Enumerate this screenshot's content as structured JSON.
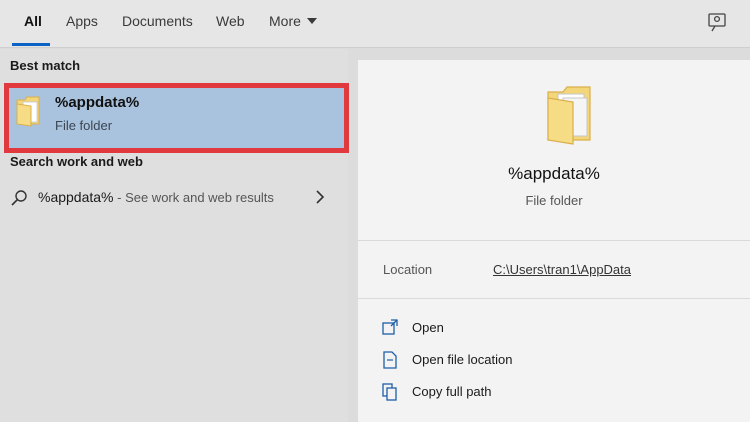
{
  "tabs": [
    {
      "label": "All",
      "active": true
    },
    {
      "label": "Apps",
      "active": false
    },
    {
      "label": "Documents",
      "active": false
    },
    {
      "label": "Web",
      "active": false
    },
    {
      "label": "More",
      "active": false
    }
  ],
  "left": {
    "best_match_heading": "Best match",
    "best_match": {
      "title": "%appdata%",
      "subtitle": "File folder",
      "icon": "folder-icon"
    },
    "web_heading": "Search work and web",
    "web_result": {
      "query": "%appdata%",
      "suffix": " - See work and web results",
      "icon": "search-icon"
    }
  },
  "preview": {
    "title": "%appdata%",
    "subtitle": "File folder",
    "location_label": "Location",
    "location_value": "C:\\Users\\tran1\\AppData",
    "actions": [
      {
        "label": "Open",
        "icon": "open-icon"
      },
      {
        "label": "Open file location",
        "icon": "file-location-icon"
      },
      {
        "label": "Copy full path",
        "icon": "copy-path-icon"
      }
    ]
  },
  "colors": {
    "accent": "#0b63c5",
    "highlight": "#a9c3de",
    "annotation_border": "#e0393e"
  }
}
